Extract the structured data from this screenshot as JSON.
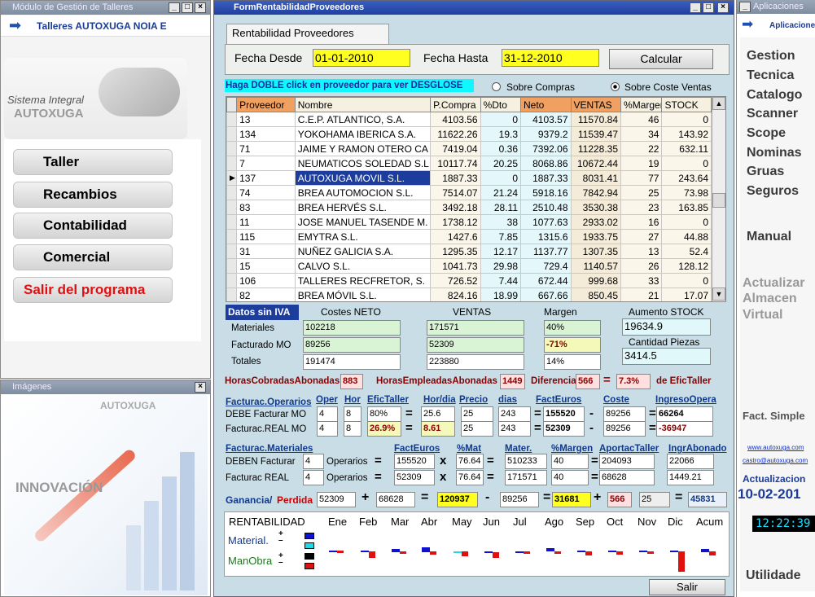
{
  "left_window": {
    "title": "Módulo de Gestión de Talleres",
    "header": "Talleres AUTOXUGA NOIA E",
    "logo_line1": "Sistema Integral",
    "logo_line2": "AUTOXUGA",
    "buttons": [
      "Taller",
      "Recambios",
      "Contabilidad",
      "Comercial",
      "Salir del programa"
    ]
  },
  "images_window": {
    "title": "Imágenes",
    "brand": "AUTOXUGA",
    "caption": "INNOVACIÓN"
  },
  "right_window": {
    "title": "Aplicaciones",
    "header": "Aplicaciones",
    "items": [
      "Gestion",
      "Tecnica",
      "Catalogo",
      "Scanner",
      "Scope",
      "Nominas",
      "Gruas",
      "Seguros"
    ],
    "manual": "Manual",
    "actualizar": [
      "Actualizar",
      "Almacen",
      "Virtual"
    ],
    "fact_simple": "Fact. Simple",
    "web": "www.autoxuga.com",
    "email": "castro@autoxuga.com",
    "actualizaciones_label": "Actualizacion",
    "actualizaciones_date": "10-02-201",
    "clock": "12:22:39",
    "utilidades": "Utilidade"
  },
  "form": {
    "title": "FormRentabilidadProveedores",
    "tab": "Rentabilidad Proveedores",
    "fecha_desde_label": "Fecha Desde",
    "fecha_desde": "01-01-2010",
    "fecha_hasta_label": "Fecha Hasta",
    "fecha_hasta": "31-12-2010",
    "calcular": "Calcular",
    "hint": "Haga DOBLE click en proveedor para ver DESGLOSE",
    "radio_compras": "Sobre Compras",
    "radio_coste": "Sobre Coste Ventas",
    "columns": [
      "Proveedor",
      "Nombre",
      "P.Compra",
      "%Dto",
      "Neto",
      "VENTAS",
      "%Margen",
      "STOCK"
    ],
    "rows": [
      [
        "13",
        "C.E.P. ATLANTICO, S.A.",
        "4103.56",
        "0",
        "4103.57",
        "11570.84",
        "46",
        "0"
      ],
      [
        "134",
        "YOKOHAMA IBERICA S.A.",
        "11622.26",
        "19.3",
        "9379.2",
        "11539.47",
        "34",
        "143.92"
      ],
      [
        "71",
        "JAIME Y RAMON OTERO CA",
        "7419.04",
        "0.36",
        "7392.06",
        "11228.35",
        "22",
        "632.11"
      ],
      [
        "7",
        "NEUMATICOS SOLEDAD S.L",
        "10117.74",
        "20.25",
        "8068.86",
        "10672.44",
        "19",
        "0"
      ],
      [
        "137",
        "AUTOXUGA MOVIL S.L.",
        "1887.33",
        "0",
        "1887.33",
        "8031.41",
        "77",
        "243.64"
      ],
      [
        "74",
        "BREA AUTOMOCION S.L.",
        "7514.07",
        "21.24",
        "5918.16",
        "7842.94",
        "25",
        "73.98"
      ],
      [
        "83",
        "BREA HERVÉS S.L.",
        "3492.18",
        "28.11",
        "2510.48",
        "3530.38",
        "23",
        "163.85"
      ],
      [
        "11",
        "JOSE MANUEL TASENDE M.",
        "1738.12",
        "38",
        "1077.63",
        "2933.02",
        "16",
        "0"
      ],
      [
        "115",
        "EMYTRA S.L.",
        "1427.6",
        "7.85",
        "1315.6",
        "1933.75",
        "27",
        "44.88"
      ],
      [
        "31",
        "NUÑEZ GALICIA S.A.",
        "1295.35",
        "12.17",
        "1137.77",
        "1307.35",
        "13",
        "52.4"
      ],
      [
        "15",
        "CALVO S.L.",
        "1041.73",
        "29.98",
        "729.4",
        "1140.57",
        "26",
        "128.12"
      ],
      [
        "106",
        "TALLERES RECFRETOR, S.",
        "726.52",
        "7.44",
        "672.44",
        "999.68",
        "33",
        "0"
      ],
      [
        "82",
        "BREA MÓVIL S.L.",
        "824.16",
        "18.99",
        "667.66",
        "850.45",
        "21",
        "17.07"
      ]
    ],
    "datos_sin_iva": "Datos sin IVA",
    "costes_neto": "Costes NETO",
    "ventas": "VENTAS",
    "margen": "Margen",
    "aumento_stock": "Aumento STOCK",
    "materiales": "Materiales",
    "facturado_mo": "Facturado MO",
    "totales": "Totales",
    "mat_coste": "102218",
    "mat_ventas": "171571",
    "mat_margen": "40%",
    "mo_coste": "89256",
    "mo_ventas": "52309",
    "mo_margen": "-71%",
    "tot_coste": "191474",
    "tot_ventas": "223880",
    "tot_margen": "14%",
    "aumento_stock_val": "19634.9",
    "cantidad_piezas": "Cantidad Piezas",
    "cantidad_piezas_val": "3414.5",
    "horas_cob_label": "HorasCobradasAbonadas",
    "horas_cob": "883",
    "horas_emp_label": "HorasEmpleadasAbonadas",
    "horas_emp": "1449",
    "diferencia_label": "Diferencia",
    "diferencia": "566",
    "dif_pct": "7.3%",
    "efic_label": "de EficTaller",
    "fo_title": "Facturac.Operarios",
    "fo_heads": [
      "Oper",
      "Hor",
      "EficTaller",
      "Hor/dia",
      "Precio",
      "dias",
      "FactEuros",
      "Coste",
      "IngresoOpera"
    ],
    "debe_label": "DEBE Facturar MO",
    "debe": [
      "4",
      "8",
      "80%",
      "25.6",
      "25",
      "243",
      "155520",
      "89256",
      "66264"
    ],
    "real_label": "Facturac.REAL MO",
    "real": [
      "4",
      "8",
      "26.9%",
      "8.61",
      "25",
      "243",
      "52309",
      "89256",
      "-36947"
    ],
    "fm_title": "Facturac.Materiales",
    "fm_heads": [
      "FactEuros",
      "%Mat",
      "Mater.",
      "%Margen",
      "AportacTaller",
      "IngrAbonado"
    ],
    "deben_label": "DEBEN Facturar",
    "deben_oper": "4",
    "operarios": "Operarios",
    "deben": [
      "155520",
      "76.64",
      "510233",
      "40",
      "204093",
      "22066"
    ],
    "freal_label": "Facturac REAL",
    "freal_oper": "4",
    "freal": [
      "52309",
      "76.64",
      "171571",
      "40",
      "68628",
      "1449.21"
    ],
    "ganancia": "Ganancia/",
    "perdida": "Perdida",
    "gp": [
      "52309",
      "68628",
      "120937",
      "89256",
      "31681",
      "566",
      "25",
      "45831"
    ],
    "rentabilidad": "RENTABILIDAD",
    "months": [
      "Ene",
      "Feb",
      "Mar",
      "Abr",
      "May",
      "Jun",
      "Jul",
      "Ago",
      "Sep",
      "Oct",
      "Nov",
      "Dic",
      "Acum"
    ],
    "material_label": "Material.",
    "manobra_label": "ManObra",
    "salir": "Salir",
    "colors": {
      "header": "#f0a060",
      "selected": "#1c3d9c",
      "panel": "#c8dde6",
      "yellow": "#ffff20"
    }
  }
}
